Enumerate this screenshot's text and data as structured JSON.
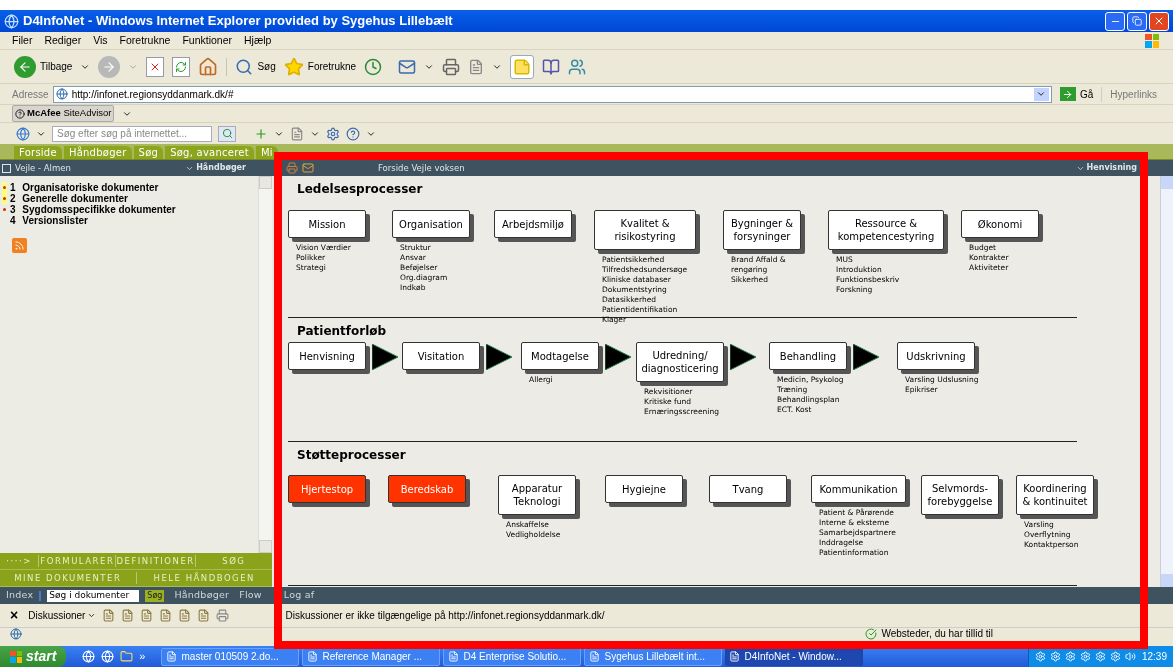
{
  "window": {
    "title": "D4InfoNet - Windows Internet Explorer provided by Sygehus Lillebælt"
  },
  "menu": [
    "Filer",
    "Rediger",
    "Vis",
    "Foretrukne",
    "Funktioner",
    "Hjælp"
  ],
  "toolbar": {
    "back": "Tilbage",
    "search": "Søg",
    "favorites": "Foretrukne"
  },
  "address": {
    "label": "Adresse",
    "value": "http://infonet.regionsyddanmark.dk/#",
    "go": "Gå",
    "links": "Hyperlinks"
  },
  "siteadvisor": {
    "label": "**McAfee** SiteAdvisor"
  },
  "search_bar": {
    "placeholder": "Søg efter søg på internettet..."
  },
  "site_tabs": [
    "Forside",
    "Håndbøger",
    "Søg",
    "Søg, avanceret",
    "Mi"
  ],
  "left_panel": {
    "title": "Vejle - Almen",
    "menu": "Håndbøger",
    "items": [
      {
        "number": "1",
        "label": "Organisatoriske dokumenter",
        "bullet": true,
        "highlighted": true
      },
      {
        "number": "2",
        "label": "Generelle dokumenter",
        "bullet": true,
        "highlighted": true
      },
      {
        "number": "3",
        "label": "Sygdomsspecifikke dokumenter",
        "bullet": true,
        "highlighted": false
      },
      {
        "number": "4",
        "label": "Versionslister",
        "bullet": false,
        "highlighted": false
      }
    ],
    "buttons": [
      [
        "····>",
        "FORMULARER",
        "DEFINITIONER",
        "SØG"
      ],
      [
        "MINE DOKUMENTER",
        "HELE HÅNDBOGEN"
      ]
    ]
  },
  "bottom_bar": {
    "index": "Index",
    "search_value": "Søg i dokumenter",
    "search_button": "Søg",
    "links": [
      "Håndbøger",
      "Flow",
      "Log af"
    ]
  },
  "main_header": {
    "title": "Forside Vejle voksen",
    "menu": "Henvisning"
  },
  "sections": [
    {
      "title": "Ledelsesprocesser",
      "kind": "group",
      "nodes": [
        {
          "label": "Mission",
          "color": "#ffffff",
          "items": [
            "Vision Værdier",
            "Polikker",
            "Strategi"
          ]
        },
        {
          "label": "Organisation",
          "color": "#ffffff",
          "items": [
            "Struktur",
            "Ansvar",
            "Beføjelser",
            "Org.diagram",
            "Indkøb"
          ]
        },
        {
          "label": "Arbejdsmiljø",
          "color": "#ffffff"
        },
        {
          "label": "Kvalitet &\nrisikostyring",
          "color": "#ffffff",
          "items": [
            "Patientsikkerhed",
            "Tilfredshedsundersøge",
            "Kliniske databaser",
            "Dokumentstyring",
            "Datasikkerhed",
            "Patientidentifikation",
            "Klager"
          ]
        },
        {
          "label": "Bygninger &\nforsyninger",
          "color": "#ffffff",
          "items": [
            "Brand Affald &",
            "rengøring",
            "Sikkerhed"
          ]
        },
        {
          "label": "Ressource &\nkompetencestyring",
          "color": "#ffffff",
          "items": [
            "MUS",
            "Introduktion",
            "Funktionsbeskriv",
            "Forskning"
          ]
        },
        {
          "label": "Økonomi",
          "color": "#ffffff",
          "items": [
            "Budget",
            "Kontrakter",
            "Aktiviteter"
          ]
        }
      ]
    },
    {
      "title": "Patientforløb",
      "kind": "flow",
      "nodes": [
        {
          "label": "Henvisning",
          "color": "#ffffff"
        },
        {
          "label": "Visitation",
          "color": "#ffffff"
        },
        {
          "label": "Modtagelse",
          "color": "#ffffff",
          "items": [
            "Allergi"
          ]
        },
        {
          "label": "Udredning/\ndiagnosticering",
          "color": "#ffffff",
          "items": [
            "Rekvisitioner",
            "Kritiske fund",
            "Ernæringsscreening"
          ]
        },
        {
          "label": "Behandling",
          "color": "#ffffff",
          "items": [
            "Medicin, Psykolog",
            "Træning",
            "Behandlingsplan",
            "ECT. Kost"
          ]
        },
        {
          "label": "Udskrivning",
          "color": "#ffffff",
          "items": [
            "Varsling Udslusning",
            "Epikriser"
          ]
        }
      ]
    },
    {
      "title": "Støtteprocesser",
      "kind": "group",
      "nodes": [
        {
          "label": "Hjertestop",
          "color": "#ff3300"
        },
        {
          "label": "Beredskab",
          "color": "#ff3300"
        },
        {
          "label": "Apparatur\nTeknologi",
          "color": "#ffffff",
          "items": [
            "Anskaffelse",
            "Vedligholdelse"
          ]
        },
        {
          "label": "Hygiejne",
          "color": "#ffffff"
        },
        {
          "label": "Tvang",
          "color": "#ffffff"
        },
        {
          "label": "Kommunikation",
          "color": "#ffffff",
          "items": [
            "Patient & Pårørende",
            "Interne & eksterne",
            "Samarbejdspartnere",
            "Inddragelse",
            "Patientinformation"
          ]
        },
        {
          "label": "Selvmords-\nforebyggelse",
          "color": "#ffffff"
        },
        {
          "label": "Koordinering\n& kontinuitet",
          "color": "#ffffff",
          "items": [
            "Varsling",
            "Overflytning",
            "Kontaktperson"
          ]
        }
      ]
    }
  ],
  "discussion_bar": {
    "close": "×",
    "label": "Diskussioner",
    "message": "Diskussioner er ikke tilgængelige på http://infonet.regionsyddanmark.dk/"
  },
  "status_bar": {
    "zone": "Websteder, du har tillid til"
  },
  "taskbar": {
    "start": "start",
    "more": "»",
    "tasks": [
      {
        "label": "master 010509 2.do...",
        "selected": false
      },
      {
        "label": "Reference Manager ...",
        "selected": false
      },
      {
        "label": "D4 Enterprise Solutio...",
        "selected": false
      },
      {
        "label": "Sygehus Lillebælt int...",
        "selected": false
      },
      {
        "label": "D4InfoNet - Window...",
        "selected": true
      }
    ],
    "clock": "12:39"
  }
}
